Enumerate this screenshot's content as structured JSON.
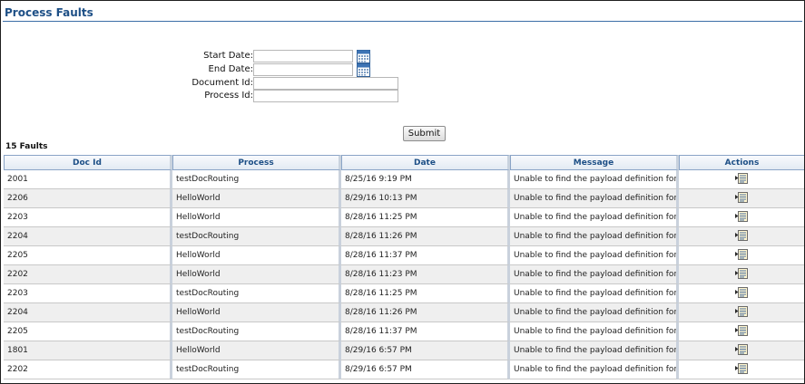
{
  "page": {
    "title": "Process Faults"
  },
  "form": {
    "start_date_label": "Start Date:",
    "end_date_label": "End Date:",
    "document_id_label": "Document Id:",
    "process_id_label": "Process Id:",
    "start_date_value": "",
    "end_date_value": "",
    "document_id_value": "",
    "process_id_value": "",
    "submit_label": "Submit"
  },
  "results": {
    "count_label": "15 Faults"
  },
  "table": {
    "columns": [
      "Doc Id",
      "Process",
      "Date",
      "Message",
      "Actions"
    ],
    "rows": [
      {
        "doc_id": "2001",
        "process": "testDocRouting",
        "date": "8/25/16 9:19 PM",
        "message": "Unable to find the payload definition for 't"
      },
      {
        "doc_id": "2206",
        "process": "HelloWorld",
        "date": "8/29/16 10:13 PM",
        "message": "Unable to find the payload definition for 't"
      },
      {
        "doc_id": "2203",
        "process": "HelloWorld",
        "date": "8/28/16 11:25 PM",
        "message": "Unable to find the payload definition for 't"
      },
      {
        "doc_id": "2204",
        "process": "testDocRouting",
        "date": "8/28/16 11:26 PM",
        "message": "Unable to find the payload definition for 't"
      },
      {
        "doc_id": "2205",
        "process": "HelloWorld",
        "date": "8/28/16 11:37 PM",
        "message": "Unable to find the payload definition for 't"
      },
      {
        "doc_id": "2202",
        "process": "HelloWorld",
        "date": "8/28/16 11:23 PM",
        "message": "Unable to find the payload definition for 't"
      },
      {
        "doc_id": "2203",
        "process": "testDocRouting",
        "date": "8/28/16 11:25 PM",
        "message": "Unable to find the payload definition for 't"
      },
      {
        "doc_id": "2204",
        "process": "HelloWorld",
        "date": "8/28/16 11:26 PM",
        "message": "Unable to find the payload definition for 't"
      },
      {
        "doc_id": "2205",
        "process": "testDocRouting",
        "date": "8/28/16 11:37 PM",
        "message": "Unable to find the payload definition for 't"
      },
      {
        "doc_id": "1801",
        "process": "HelloWorld",
        "date": "8/29/16 6:57 PM",
        "message": "Unable to find the payload definition for 't"
      },
      {
        "doc_id": "2202",
        "process": "testDocRouting",
        "date": "8/29/16 6:57 PM",
        "message": "Unable to find the payload definition for 't"
      }
    ],
    "row_action_icon": "view-details-icon"
  },
  "icons": {
    "calendar": "calendar-icon"
  },
  "colors": {
    "title": "#1d4f86",
    "header_border": "#8aa4c6",
    "row_alt": "#efefef"
  }
}
